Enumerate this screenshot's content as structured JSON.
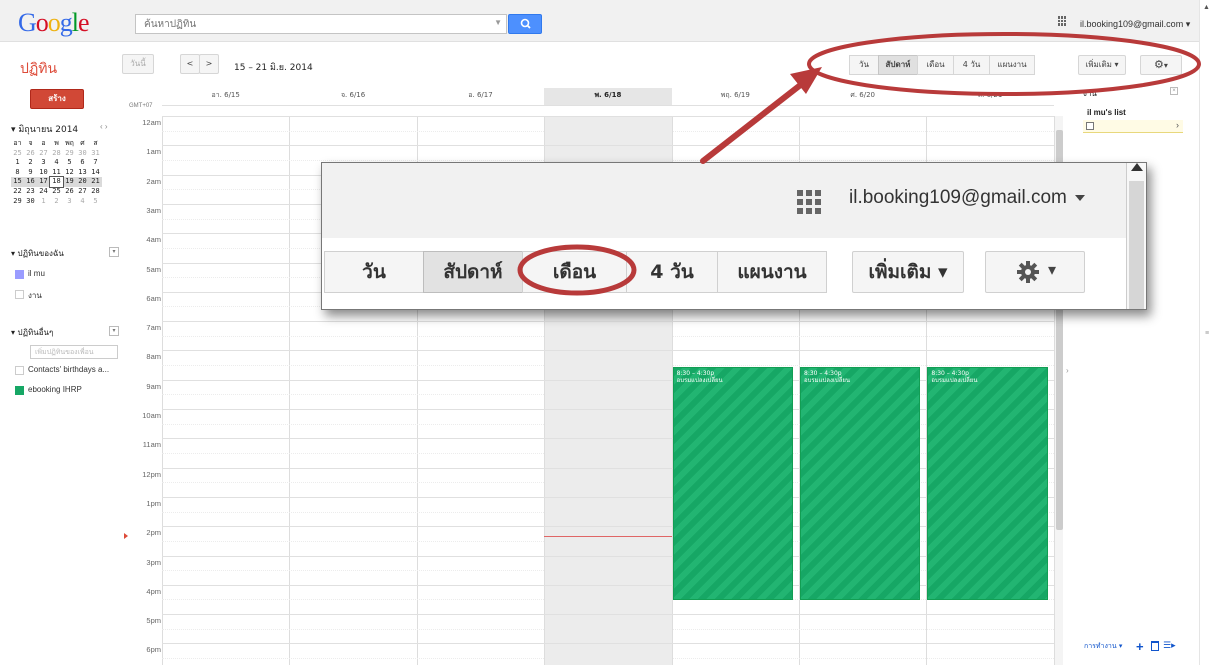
{
  "header": {
    "logo_letters": [
      {
        "ch": "G",
        "color": "#3369e8"
      },
      {
        "ch": "o",
        "color": "#d50f25"
      },
      {
        "ch": "o",
        "color": "#eeb211"
      },
      {
        "ch": "g",
        "color": "#3369e8"
      },
      {
        "ch": "l",
        "color": "#009925"
      },
      {
        "ch": "e",
        "color": "#d50f25"
      }
    ],
    "search_placeholder": "ค้นหาปฏิทิน",
    "account_email": "il.booking109@gmail.com ▾"
  },
  "toolbar": {
    "app_title": "ปฏิทิน",
    "today_label": "วันนี้",
    "prev_label": "<",
    "next_label": ">",
    "date_range": "15 – 21 มิ.ย. 2014",
    "views": [
      "วัน",
      "สัปดาห์",
      "เดือน",
      "4 วัน",
      "แผนงาน"
    ],
    "active_view": "สัปดาห์",
    "more_label": "เพิ่มเติม ▾",
    "settings_caret": "▾"
  },
  "sidebar": {
    "create_label": "สร้าง",
    "mini_month": "▾ มิถุนายน 2014",
    "mini_nav": "‹  ›",
    "weekday_header": [
      "อา",
      "จ",
      "อ",
      "พ",
      "พฤ",
      "ศ",
      "ส"
    ],
    "weeks": [
      [
        "25",
        "26",
        "27",
        "28",
        "29",
        "30",
        "31"
      ],
      [
        "1",
        "2",
        "3",
        "4",
        "5",
        "6",
        "7"
      ],
      [
        "8",
        "9",
        "10",
        "11",
        "12",
        "13",
        "14"
      ],
      [
        "15",
        "16",
        "17",
        "18",
        "19",
        "20",
        "21"
      ],
      [
        "22",
        "23",
        "24",
        "25",
        "26",
        "27",
        "28"
      ],
      [
        "29",
        "30",
        "1",
        "2",
        "3",
        "4",
        "5"
      ]
    ],
    "selected_day": "18",
    "my_calendars_title": "▾ ปฏิทินของฉัน",
    "my_calendars": [
      {
        "name": "il mu",
        "color": "#9a9cff",
        "checked": true
      },
      {
        "name": "งาน",
        "color": "#ffffff",
        "checked": false
      }
    ],
    "other_calendars_title": "▾ ปฏิทินอื่นๆ",
    "add_friend_placeholder": "เพิ่มปฏิทินของเพื่อน",
    "other_calendars": [
      {
        "name": "Contacts' birthdays a...",
        "color": "#ffffff",
        "checked": false
      },
      {
        "name": "ebooking IHRP",
        "color": "#16a765",
        "checked": true
      }
    ],
    "toggle_symbol": "▾"
  },
  "grid": {
    "timezone": "GMT+07",
    "days": [
      "อา. 6/15",
      "จ. 6/16",
      "อ. 6/17",
      "พ. 6/18",
      "พฤ. 6/19",
      "ศ. 6/20",
      "ส. 6/21"
    ],
    "today_index": 3,
    "hours": [
      "12am",
      "1am",
      "2am",
      "3am",
      "4am",
      "5am",
      "6am",
      "7am",
      "8am",
      "9am",
      "10am",
      "11am",
      "12pm",
      "1pm",
      "2pm",
      "3pm",
      "4pm",
      "5pm",
      "6pm"
    ],
    "events": [
      {
        "day_index": 4,
        "time": "8:30 – 4:30p",
        "title": "อบรมแปลงเปลี่ยน"
      },
      {
        "day_index": 5,
        "time": "8:30 – 4:30p",
        "title": "อบรมแปลงเปลี่ยน"
      },
      {
        "day_index": 6,
        "time": "8:30 – 4:30p",
        "title": "อบรมแปลงเปลี่ยน"
      }
    ],
    "event_color": "#16a765"
  },
  "tasks": {
    "title": "งาน",
    "close_symbol": "×",
    "list_name": "il mu's list",
    "actions_label": "การทำงาน ▾",
    "plus": "+",
    "list_symbol": "☰▸",
    "expand_symbol": "›"
  },
  "zoom": {
    "account_email": "il.booking109@gmail.com",
    "views": [
      "วัน",
      "สัปดาห์",
      "เดือน",
      "4 วัน",
      "แผนงาน"
    ],
    "active_view": "สัปดาห์",
    "highlighted_view": "เดือน",
    "more_label": "เพิ่มเติม ▾",
    "settings_caret": "▾"
  },
  "annotation": {
    "color": "#b83a3a"
  }
}
